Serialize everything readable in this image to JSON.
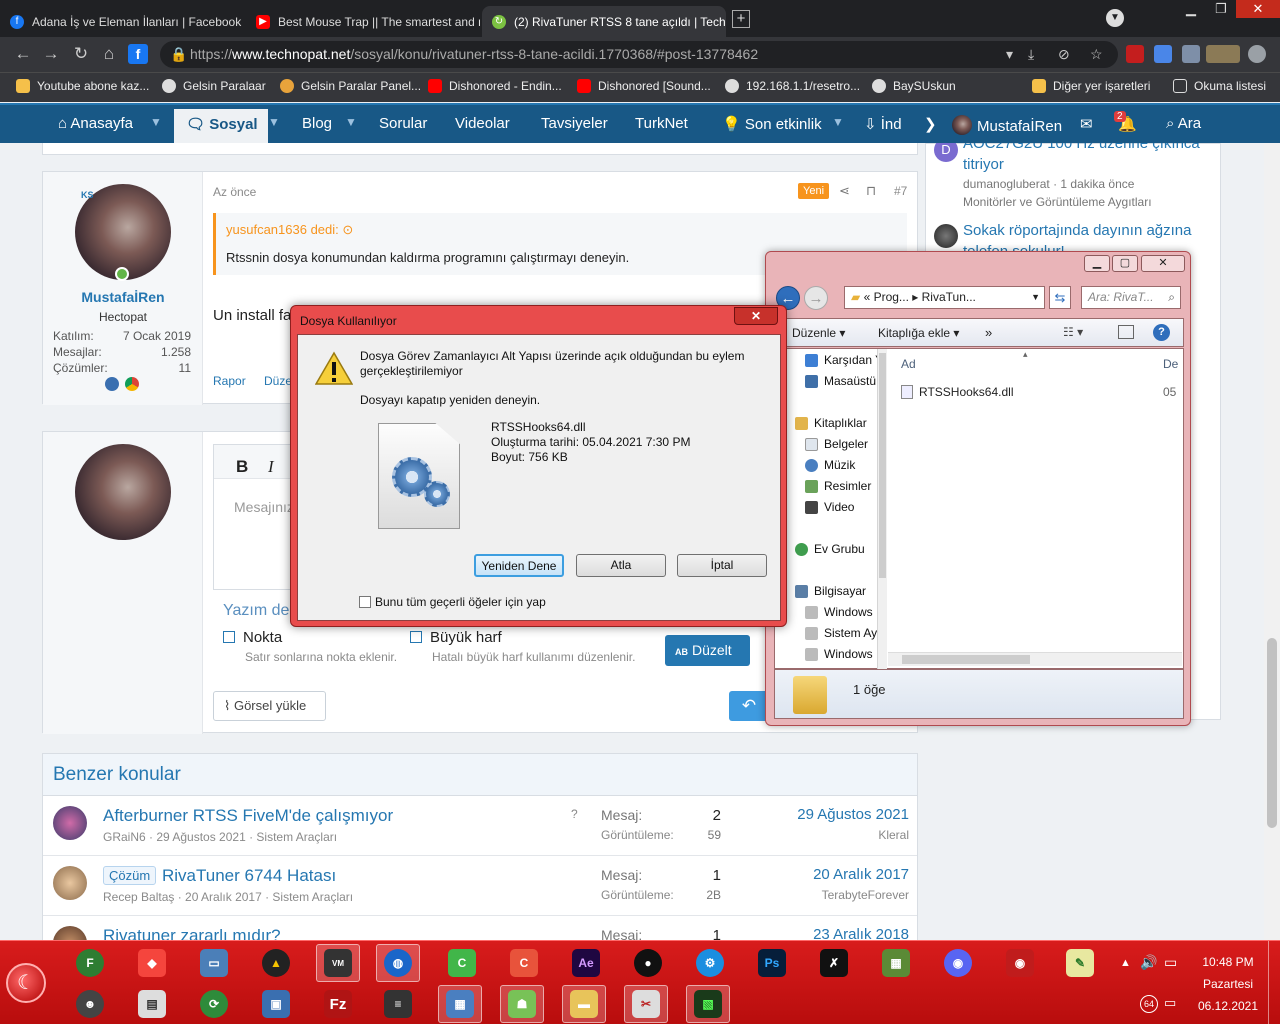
{
  "browser": {
    "tabs": [
      {
        "title": "Adana İş ve Eleman İlanları | Facebook",
        "icon": "facebook-icon"
      },
      {
        "title": "Best Mouse Trap || The smartest and n",
        "icon": "youtube-icon"
      },
      {
        "title": "(2) RivaTuner RTSS 8 tane açıldı | Techn",
        "icon": "technopat-icon"
      }
    ],
    "url_prefix": "https://",
    "url_host": "www.technopat.net",
    "url_path": "/sosyal/konu/rivatuner-rtss-8-tane-acildi.1770368/#post-13778462",
    "bookmarks": [
      "Youtube abone kaz...",
      "Gelsin Paralaar",
      "Gelsin Paralar Panel...",
      "Dishonored - Endin...",
      "Dishonored [Sound...",
      "192.168.1.1/resetro...",
      "BaySUskun"
    ],
    "bookmarks_other": "Diğer yer işaretleri",
    "reading_list": "Okuma listesi"
  },
  "sitenav": {
    "items": [
      "Anasayfa",
      "Sosyal",
      "Blog",
      "Sorular",
      "Videolar",
      "Tavsiyeler",
      "TurkNet",
      "Son etkinlik",
      "İnd"
    ],
    "user": "MustafaİRen",
    "alerts_count": "2",
    "search": "Ara"
  },
  "post": {
    "time": "Az önce",
    "new_badge": "Yeni",
    "number": "#7",
    "quote_author": "yusufcan1636 dedi:",
    "quote_text": "Rtssnin dosya konumundan kaldırma programını çalıştırmayı deneyin.",
    "body": "Un install fa",
    "report": "Rapor",
    "edit": "Düze",
    "user": {
      "name": "MustafaİRen",
      "title": "Hectopat",
      "badge": "KS",
      "stats": [
        {
          "label": "Katılım:",
          "value": "7 Ocak 2019"
        },
        {
          "label": "Mesajlar:",
          "value": "1.258"
        },
        {
          "label": "Çözümler:",
          "value": "11"
        }
      ]
    }
  },
  "editor": {
    "bold": "B",
    "italic": "I",
    "placeholder": "Mesajınız",
    "writing_hint": "Yazım de",
    "option1": "Nokta",
    "option1_hint": "Satır sonlarına nokta eklenir.",
    "option2": "Büyük harf",
    "option2_hint": "Hatalı büyük harf kullanımı düzenlenir.",
    "fix_button": "Düzelt",
    "upload": "Görsel yükle"
  },
  "related": {
    "title": "Benzer konular",
    "stat_msg": "Mesaj:",
    "stat_views": "Görüntüleme:",
    "threads": [
      {
        "title": "Afterburner RTSS FiveM'de çalışmıyor",
        "prefix": "",
        "meta": "GRaiN6 · 29 Ağustos 2021 · Sistem Araçları",
        "messages": "2",
        "views": "59",
        "date": "29 Ağustos 2021",
        "last_user": "Kleral"
      },
      {
        "title": "RivaTuner 6744 Hatası",
        "prefix": "Çözüm",
        "meta": "Recep Baltaş · 20 Aralık 2017 · Sistem Araçları",
        "messages": "1",
        "views": "2B",
        "date": "20 Aralık 2017",
        "last_user": "TerabyteForever"
      },
      {
        "title": "Rivatuner zararlı mıdır?",
        "prefix": "",
        "meta": "",
        "messages": "1",
        "views": "",
        "date": "23 Aralık 2018",
        "last_user": ""
      }
    ]
  },
  "sidebar": {
    "item1_title_a": "AOC27G2U 100 Hz üzerine çıkınca",
    "item1_title_b": "titriyor",
    "item1_meta": "dumanogluberat · 1 dakika önce",
    "item1_forum": "Monitörler ve Görüntüleme Aygıtları",
    "item1_avatar": "D",
    "item2_title_a": "Sokak röportajında dayının ağzına",
    "item2_title_b": "telefon sokulur!"
  },
  "explorer": {
    "path": [
      "« Prog...",
      "RivaTun..."
    ],
    "search_placeholder": "Ara: RivaT...",
    "toolbar": [
      "Düzenle",
      "Kitaplığa ekle",
      "»"
    ],
    "nav": [
      "Karşıdan Y",
      "Masaüstü",
      "Kitaplıklar",
      "Belgeler",
      "Müzik",
      "Resimler",
      "Video",
      "Ev Grubu",
      "Bilgisayar",
      "Windows",
      "Sistem Ay",
      "Windows"
    ],
    "col_name": "Ad",
    "col_date": "De",
    "file_name": "RTSSHooks64.dll",
    "file_date": "05",
    "status": "1 öğe"
  },
  "dialog": {
    "title": "Dosya Kullanılıyor",
    "message": "Dosya Görev Zamanlayıcı Alt Yapısı üzerinde açık olduğundan bu eylem gerçekleştirilemiyor",
    "hint": "Dosyayı kapatıp yeniden deneyin.",
    "file_name": "RTSSHooks64.dll",
    "file_created": "Oluşturma tarihi: 05.04.2021 7:30 PM",
    "file_size": "Boyut: 756 KB",
    "retry": "Yeniden Dene",
    "skip": "Atla",
    "cancel": "İptal",
    "apply_all": "Bunu tüm geçerli öğeler için yap"
  },
  "taskbar": {
    "time": "10:48 PM",
    "day": "Pazartesi",
    "date": "06.12.2021",
    "tray_badge": "64"
  },
  "colors": {
    "nav": "#185886",
    "accent": "#2577b1",
    "taskbar": "#c91414",
    "dialog_frame": "#e84c4c"
  }
}
